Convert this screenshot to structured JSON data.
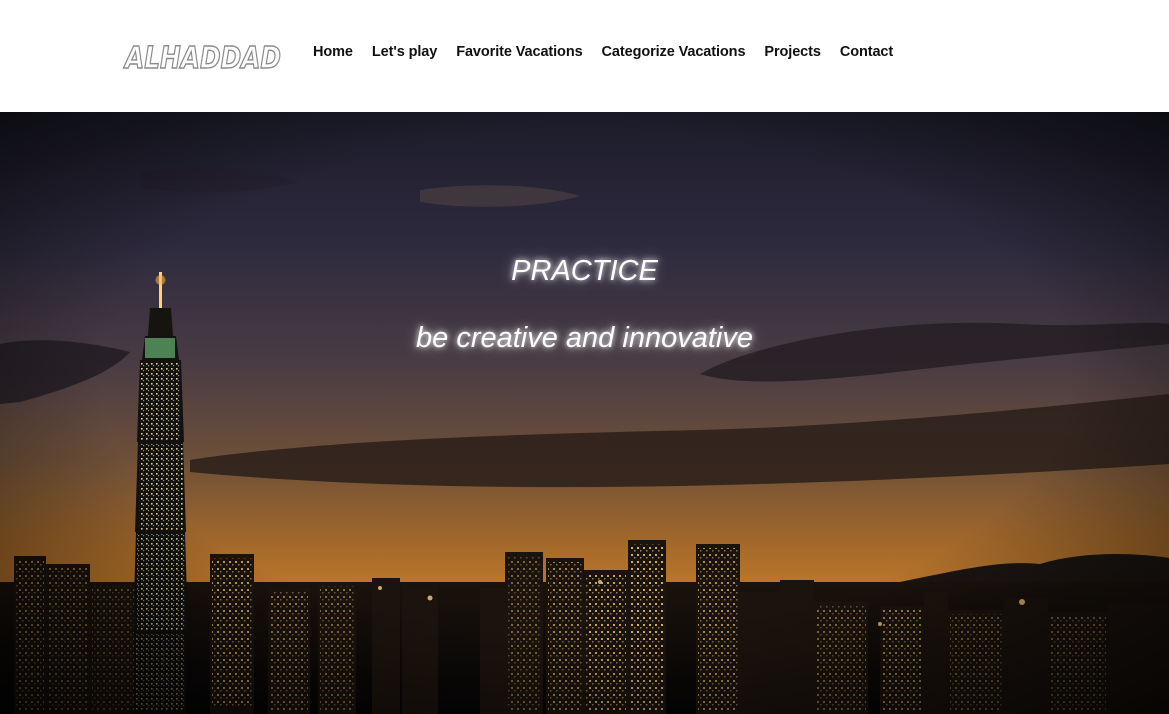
{
  "brand": {
    "logo_text": "ALHADDAD"
  },
  "nav": {
    "items": [
      {
        "label": "Home"
      },
      {
        "label": "Let's play"
      },
      {
        "label": "Favorite Vacations"
      },
      {
        "label": "Categorize Vacations"
      },
      {
        "label": "Projects"
      },
      {
        "label": "Contact"
      }
    ]
  },
  "hero": {
    "title": "PRACTICE",
    "subtitle": "be creative and innovative",
    "image_subject": "night city skyline"
  },
  "colors": {
    "nav_text": "#111111",
    "header_bg": "#ffffff",
    "hero_text": "#ffffff"
  }
}
